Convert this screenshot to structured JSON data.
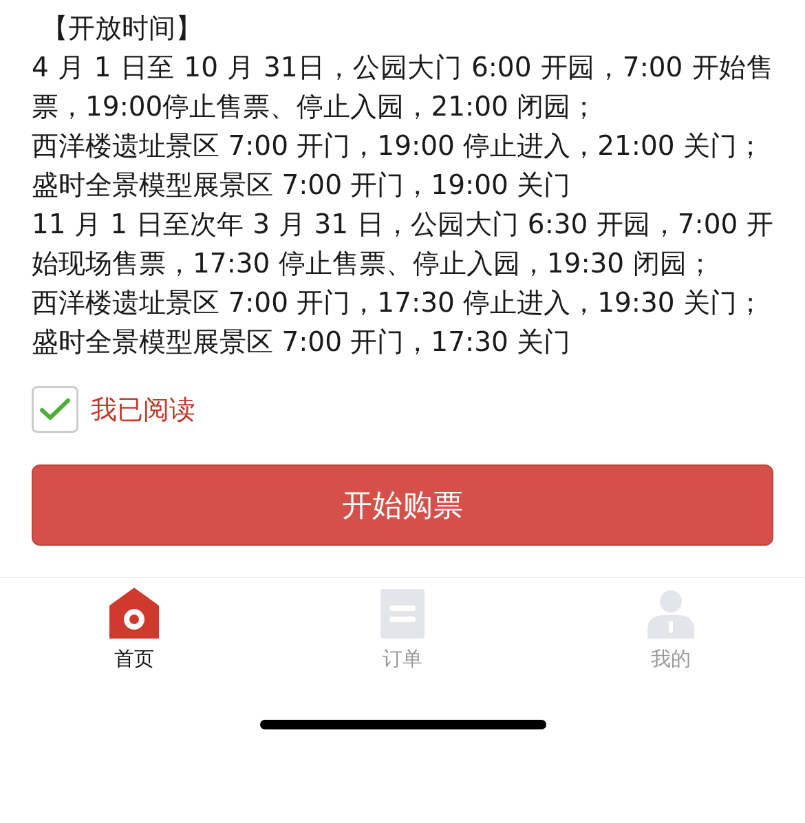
{
  "section": {
    "heading": "【开放时间】",
    "paragraphs": [
      "4 月 1 日至 10 月 31日，公园大门 6:00 开园，7:00 开始售票，19:00停止售票、停止入园，21:00 闭园；",
      "西洋楼遗址景区 7:00 开门，19:00 停止进入，21:00 关门；",
      "盛时全景模型展景区 7:00 开门，19:00 关门",
      "11 月 1 日至次年 3 月 31 日，公园大门 6:30 开园，7:00 开始现场售票，17:30 停止售票、停止入园，19:30 闭园；",
      "西洋楼遗址景区 7:00 开门，17:30 停止进入，19:30 关门；",
      "盛时全景模型展景区 7:00 开门，17:30 关门"
    ]
  },
  "agreement": {
    "label": "我已阅读",
    "checked": true
  },
  "buy_button": "开始购票",
  "tabs": [
    {
      "kind": "home",
      "label": "首页",
      "selected": true
    },
    {
      "kind": "orders",
      "label": "订单",
      "selected": false
    },
    {
      "kind": "profile",
      "label": "我的",
      "selected": false
    }
  ]
}
